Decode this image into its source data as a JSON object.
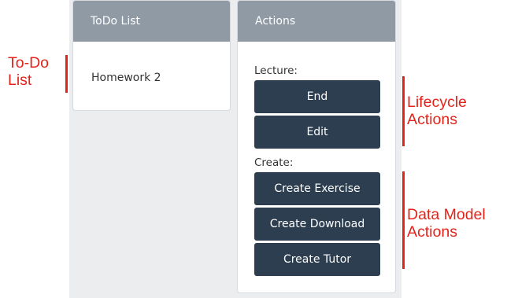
{
  "todo_panel": {
    "header": "ToDo List",
    "items": [
      "Homework 2"
    ]
  },
  "actions_panel": {
    "header": "Actions",
    "lecture_label": "Lecture:",
    "lifecycle_buttons": [
      "End",
      "Edit"
    ],
    "create_label": "Create:",
    "create_buttons": [
      "Create Exercise",
      "Create Download",
      "Create Tutor"
    ]
  },
  "annotations": {
    "todo": [
      "To-Do",
      "List"
    ],
    "lifecycle": [
      "Lifecycle",
      "Actions"
    ],
    "data_model": [
      "Data Model",
      "Actions"
    ]
  },
  "colors": {
    "header_bg": "#8f9aa5",
    "button_bg": "#2d3e50",
    "annotation_red": "#e3231a",
    "panel_bg": "#ecedef"
  }
}
